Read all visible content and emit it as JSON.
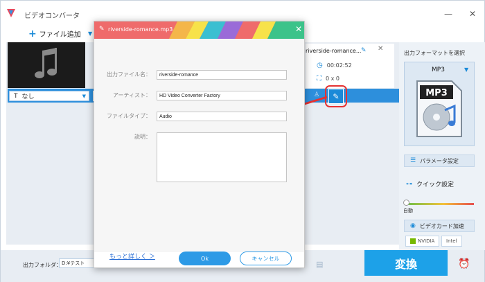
{
  "app": {
    "title": "ビデオコンバータ",
    "window_controls": {
      "minimize": "—",
      "close": "✕"
    }
  },
  "toolbar": {
    "add_file_label": "ファイル追加"
  },
  "file_item": {
    "name": "riverside-romance...",
    "duration": "00:02:52",
    "resolution": "0 x 0",
    "subtitle_select": "なし"
  },
  "right_panel": {
    "output_format_label": "出力フォーマットを選択",
    "format_name": "MP3",
    "format_icon_text": "MP3",
    "param_settings_label": "パラメータ設定",
    "quick_settings_label": "クイック設定",
    "slider_value_label": "自動",
    "slider_level": 0,
    "gpu_accel_label": "ビデオカード加速",
    "gpu_badges": [
      "NVIDIA",
      "Intel"
    ]
  },
  "bottom": {
    "output_folder_label": "出力フォルダ：",
    "output_folder_value": "D:¥テスト",
    "convert_label": "変換"
  },
  "dialog": {
    "title": "riverside-romance.mp3",
    "fields": {
      "output_name": {
        "label": "出力ファイル名：",
        "value": "riverside-romance"
      },
      "artist": {
        "label": "アーティスト：",
        "value": "HD Video Converter Factory"
      },
      "file_type": {
        "label": "ファイルタイプ：",
        "value": "Audio"
      },
      "description": {
        "label": "説明：",
        "value": ""
      }
    },
    "more_link": "もっと詳しく ＞",
    "ok_label": "Ok",
    "cancel_label": "キャンセル"
  },
  "colors": {
    "accent": "#1a8ad8",
    "convert_button": "#1da1e8",
    "highlight_ring": "#e53232",
    "header_stripes": [
      "#ef6b6b",
      "#f4b64a",
      "#f7e24a",
      "#6cc24a",
      "#3bbfd1",
      "#9a6bd8",
      "#ef6b6b"
    ]
  }
}
